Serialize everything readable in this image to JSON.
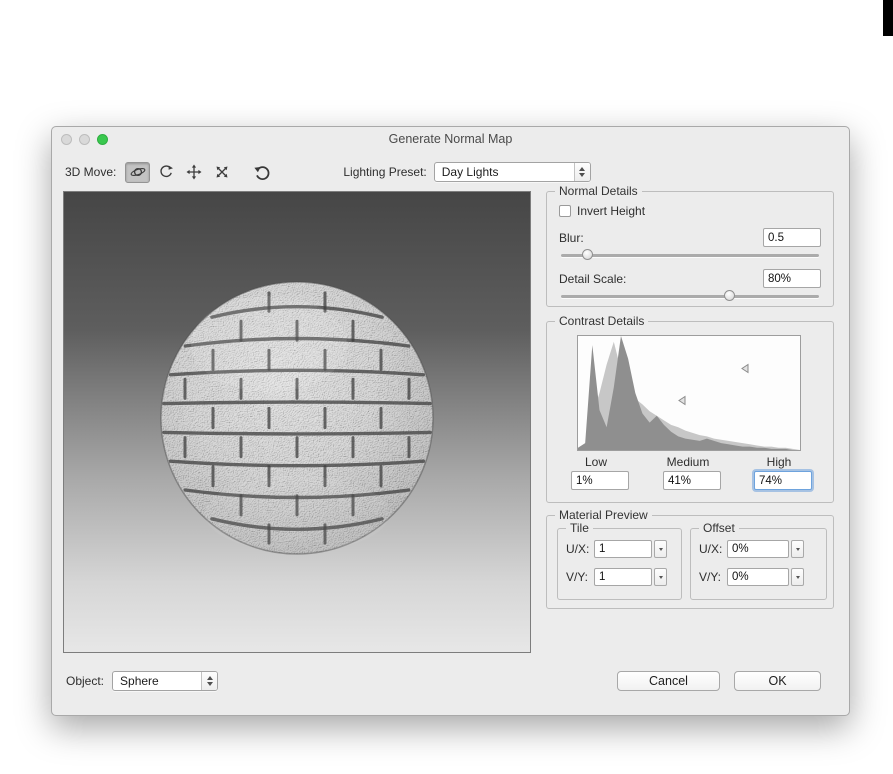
{
  "window": {
    "title": "Generate Normal Map"
  },
  "toolbar": {
    "move_label": "3D Move:",
    "tools": [
      {
        "name": "orbit",
        "selected": true
      },
      {
        "name": "roll",
        "selected": false
      },
      {
        "name": "pan",
        "selected": false
      },
      {
        "name": "slide",
        "selected": false
      }
    ],
    "lighting_label": "Lighting Preset:",
    "lighting_value": "Day Lights"
  },
  "normal_details": {
    "legend": "Normal Details",
    "invert_height_label": "Invert Height",
    "invert_height_checked": false,
    "blur_label": "Blur:",
    "blur_value": "0.5",
    "blur_slider_percent": 10,
    "detail_scale_label": "Detail Scale:",
    "detail_scale_value": "80%",
    "detail_scale_slider_percent": 65
  },
  "contrast_details": {
    "legend": "Contrast Details",
    "low_label": "Low",
    "medium_label": "Medium",
    "high_label": "High",
    "low_value": "1%",
    "medium_value": "41%",
    "high_value": "74%",
    "markers": {
      "medium": {
        "x": 47,
        "y": 56
      },
      "high": {
        "x": 75,
        "y": 28
      }
    },
    "histogram_dark": [
      0.02,
      0.06,
      0.92,
      0.35,
      0.2,
      0.55,
      1,
      0.8,
      0.5,
      0.32,
      0.24,
      0.3,
      0.22,
      0.16,
      0.12,
      0.1,
      0.09,
      0.08,
      0.1,
      0.08,
      0.06,
      0.05,
      0.04,
      0.03,
      0.03,
      0.02,
      0.02,
      0.01,
      0.01,
      0.01,
      0,
      0
    ],
    "histogram_light": [
      0.01,
      0.03,
      0.3,
      0.5,
      0.75,
      0.95,
      0.7,
      0.55,
      0.45,
      0.4,
      0.34,
      0.3,
      0.26,
      0.22,
      0.2,
      0.17,
      0.15,
      0.13,
      0.12,
      0.1,
      0.09,
      0.08,
      0.07,
      0.06,
      0.05,
      0.04,
      0.03,
      0.03,
      0.02,
      0.02,
      0.01,
      0
    ]
  },
  "material_preview": {
    "legend": "Material Preview",
    "tile": {
      "legend": "Tile",
      "ux_label": "U/X:",
      "ux_value": "1",
      "vy_label": "V/Y:",
      "vy_value": "1"
    },
    "offset": {
      "legend": "Offset",
      "ux_label": "U/X:",
      "ux_value": "0%",
      "vy_label": "V/Y:",
      "vy_value": "0%"
    }
  },
  "footer": {
    "object_label": "Object:",
    "object_value": "Sphere",
    "cancel_label": "Cancel",
    "ok_label": "OK"
  }
}
